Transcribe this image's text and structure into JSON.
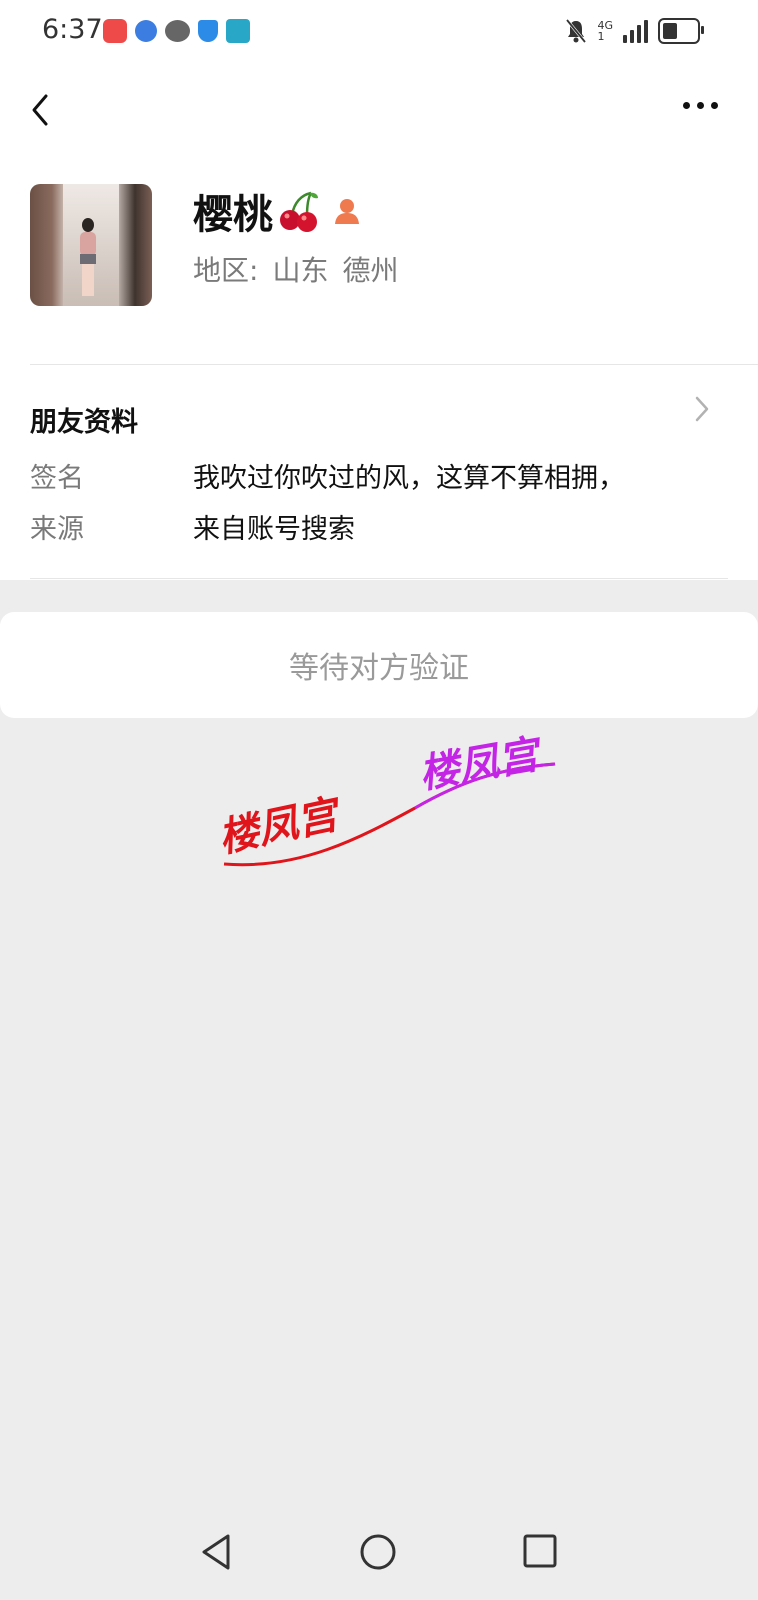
{
  "status_bar": {
    "time": "6:37",
    "network_label": "4G",
    "signal_sub_label": "1",
    "battery_level": 0.45,
    "notification_icons": [
      "huawei-store-icon",
      "globe-icon",
      "chat-icon",
      "shield-icon",
      "book-icon"
    ],
    "system_icons": [
      "bell-off-icon",
      "signal-icon",
      "battery-icon"
    ]
  },
  "header": {
    "back_icon": "chevron-left-icon",
    "more_icon": "more-dots-icon"
  },
  "profile": {
    "name": "樱桃",
    "name_emoji": "cherry-icon",
    "badge_icon": "user-icon",
    "region_label": "地区:",
    "region_province": "山东",
    "region_city": "德州"
  },
  "friend_info": {
    "title": "朋友资料",
    "rows": [
      {
        "label": "签名",
        "value": "我吹过你吹过的风，这算不算相拥，"
      },
      {
        "label": "来源",
        "value": "来自账号搜索"
      }
    ]
  },
  "action": {
    "verify_label": "等待对方验证"
  },
  "watermark": {
    "text_left": "楼凤宫",
    "text_right": "楼凤宫"
  },
  "colors": {
    "background": "#ededed",
    "card": "#ffffff",
    "muted_text": "#7a7a7a",
    "watermark_red": "#e0141b",
    "watermark_purple": "#c424e6"
  },
  "nav_bar": {
    "icons": [
      "nav-back-icon",
      "nav-home-icon",
      "nav-recent-icon"
    ]
  }
}
